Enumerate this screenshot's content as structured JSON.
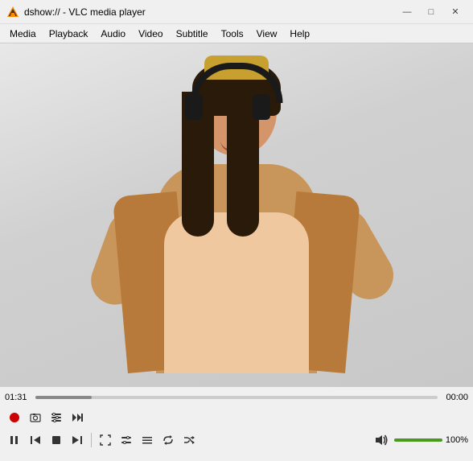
{
  "titlebar": {
    "icon": "vlc",
    "title": "dshow:// - VLC media player",
    "minimize": "—",
    "maximize": "□",
    "close": "✕"
  },
  "menubar": {
    "items": [
      "Media",
      "Playback",
      "Audio",
      "Video",
      "Subtitle",
      "Tools",
      "View",
      "Help"
    ]
  },
  "seekbar": {
    "current": "01:31",
    "total": "00:00",
    "fill_pct": "14"
  },
  "controls_row1": {
    "buttons": [
      {
        "name": "record-button",
        "icon": "⏺",
        "label": "Record"
      },
      {
        "name": "snapshot-button",
        "icon": "📷",
        "label": "Snapshot"
      },
      {
        "name": "extended-button",
        "icon": "⚙",
        "label": "Extended"
      },
      {
        "name": "fast-forward-button",
        "icon": "▶▶",
        "label": "Fast Forward"
      }
    ]
  },
  "controls_row2": {
    "buttons": [
      {
        "name": "play-pause-button",
        "icon": "⏸",
        "label": "Play/Pause"
      },
      {
        "name": "prev-chapter-button",
        "icon": "⏮",
        "label": "Previous Chapter"
      },
      {
        "name": "stop-button",
        "icon": "⏹",
        "label": "Stop"
      },
      {
        "name": "next-chapter-button",
        "icon": "⏭",
        "label": "Next Chapter"
      },
      {
        "name": "fullscreen-button",
        "icon": "⛶",
        "label": "Fullscreen"
      },
      {
        "name": "extended2-button",
        "icon": "🎚",
        "label": "Extended Settings"
      },
      {
        "name": "playlist-button",
        "icon": "≡",
        "label": "Playlist"
      },
      {
        "name": "loop-button",
        "icon": "🔁",
        "label": "Loop"
      },
      {
        "name": "random-button",
        "icon": "🔀",
        "label": "Random"
      }
    ],
    "volume": {
      "icon": "🔊",
      "pct": "100%",
      "fill_pct": "100"
    }
  }
}
